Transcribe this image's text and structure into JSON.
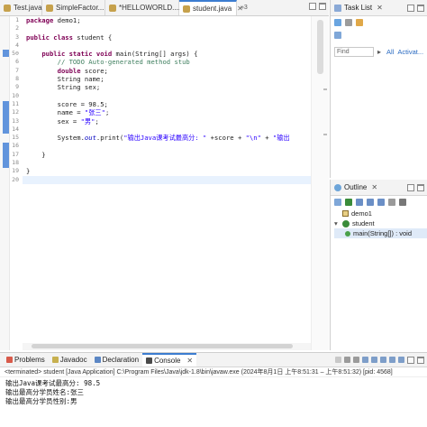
{
  "editor_tabs": [
    {
      "label": "Test.java",
      "active": false
    },
    {
      "label": "SimpleFactor...",
      "active": false
    },
    {
      "label": "*HELLOWORLD....",
      "active": false
    },
    {
      "label": "student.java",
      "active": true
    }
  ],
  "tab_overflow": "»",
  "tab_overflow_count": "3",
  "code_lines": [
    {
      "n": "1",
      "tokens": [
        {
          "t": "kw",
          "v": "package"
        },
        {
          "t": "",
          "v": " demo1;"
        }
      ]
    },
    {
      "n": "2",
      "tokens": []
    },
    {
      "n": "3",
      "tokens": [
        {
          "t": "kw",
          "v": "public class"
        },
        {
          "t": "",
          "v": " student {"
        }
      ]
    },
    {
      "n": "4",
      "tokens": []
    },
    {
      "n": "5⊖",
      "tokens": [
        {
          "t": "",
          "v": "    "
        },
        {
          "t": "kw",
          "v": "public static void"
        },
        {
          "t": "",
          "v": " main(String[] args) {"
        }
      ]
    },
    {
      "n": "6",
      "tokens": [
        {
          "t": "",
          "v": "        "
        },
        {
          "t": "cm",
          "v": "// TODO Auto-generated method stub"
        }
      ]
    },
    {
      "n": "7",
      "tokens": [
        {
          "t": "",
          "v": "        "
        },
        {
          "t": "kw",
          "v": "double"
        },
        {
          "t": "",
          "v": " score;"
        }
      ]
    },
    {
      "n": "8",
      "tokens": [
        {
          "t": "",
          "v": "        String name;"
        }
      ]
    },
    {
      "n": "9",
      "tokens": [
        {
          "t": "",
          "v": "        String sex;"
        }
      ]
    },
    {
      "n": "10",
      "tokens": []
    },
    {
      "n": "11",
      "tokens": [
        {
          "t": "",
          "v": "        score = 98.5;"
        }
      ]
    },
    {
      "n": "12",
      "tokens": [
        {
          "t": "",
          "v": "        name = "
        },
        {
          "t": "st",
          "v": "\"张三\""
        },
        {
          "t": "",
          "v": ";"
        }
      ]
    },
    {
      "n": "13",
      "tokens": [
        {
          "t": "",
          "v": "        sex = "
        },
        {
          "t": "st",
          "v": "\"男\""
        },
        {
          "t": "",
          "v": ";"
        }
      ]
    },
    {
      "n": "14",
      "tokens": []
    },
    {
      "n": "15",
      "tokens": [
        {
          "t": "",
          "v": "        System."
        },
        {
          "t": "fld",
          "v": "out"
        },
        {
          "t": "",
          "v": ".print("
        },
        {
          "t": "st",
          "v": "\"输出Java课考试最高分: \""
        },
        {
          "t": "",
          "v": " +score + "
        },
        {
          "t": "st",
          "v": "\"\\n\""
        },
        {
          "t": "",
          "v": " + "
        },
        {
          "t": "st",
          "v": "\"输出"
        }
      ]
    },
    {
      "n": "16",
      "tokens": []
    },
    {
      "n": "17",
      "tokens": [
        {
          "t": "",
          "v": "    }"
        }
      ]
    },
    {
      "n": "18",
      "tokens": []
    },
    {
      "n": "19",
      "tokens": [
        {
          "t": "",
          "v": "}"
        }
      ]
    },
    {
      "n": "20",
      "tokens": []
    }
  ],
  "task_list": {
    "title": "Task List",
    "find_placeholder": "Find",
    "all_label": "All",
    "activate_label": "Activat..."
  },
  "outline": {
    "title": "Outline",
    "package": "demo1",
    "class_name": "student",
    "method": "main(String[]) : void"
  },
  "bottom_tabs": [
    {
      "label": "Problems",
      "active": false
    },
    {
      "label": "Javadoc",
      "active": false
    },
    {
      "label": "Declaration",
      "active": false
    },
    {
      "label": "Console",
      "active": true
    }
  ],
  "console": {
    "terminated_line": "<terminated> student [Java Application] C:\\Program Files\\Java\\jdk-1.8\\bin\\javaw.exe  (2024年8月1日 上午8:51:31 – 上午8:51:32) [pid: 4568]",
    "output": [
      "输出Java课考试最高分: 98.5",
      "输出最高分学员姓名:张三",
      "输出最高分学员性别:男"
    ]
  },
  "colors": {
    "accent": "#3c7dd0",
    "keyword": "#7f0055",
    "comment": "#3f7f5f",
    "string": "#2a00ff"
  }
}
